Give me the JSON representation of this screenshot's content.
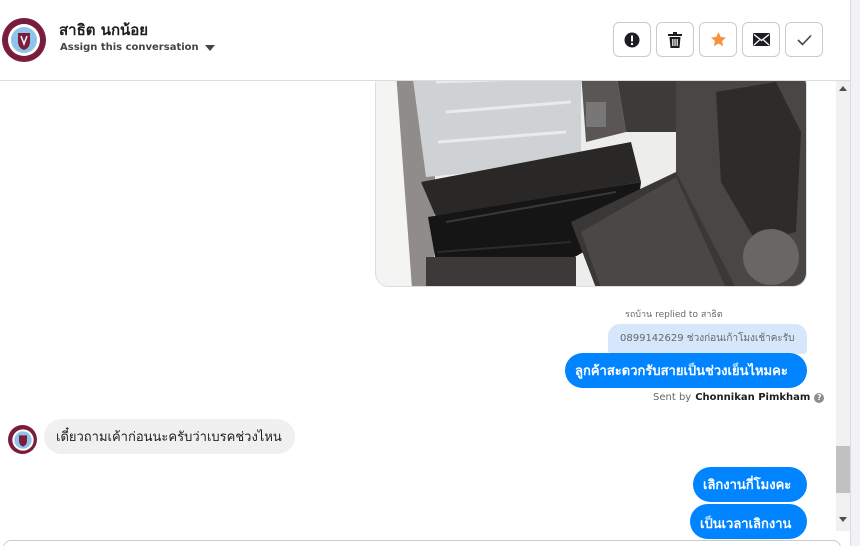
{
  "header": {
    "contact_name": "สาธิต นกน้อย",
    "assign_label": "Assign this conversation",
    "actions": [
      {
        "name": "mark-spam",
        "icon": "exclamation-icon"
      },
      {
        "name": "delete",
        "icon": "trash-icon"
      },
      {
        "name": "star",
        "icon": "star-icon"
      },
      {
        "name": "mark-unread",
        "icon": "envelope-icon"
      },
      {
        "name": "mark-done",
        "icon": "check-icon"
      }
    ]
  },
  "colors": {
    "accent": "#0084ff",
    "star": "#f7913d",
    "incoming_bubble": "#f0f0f0",
    "quoted_bubble": "#d6e6fb",
    "avatar_bg": "#7a1c3c"
  },
  "messages": {
    "reply_note": "รถบ้าน replied to สาธิต",
    "quoted_text": "0899142629 ช่วงก่อนเก้าโมงเช้าคะรับ",
    "outgoing_1": "ลูกค้าสะดวกรับสายเป็นช่วงเย็นไหมคะ",
    "sent_by_prefix": "Sent by",
    "sent_by_name": "Chonnikan Pimkham",
    "incoming_1": "เดี๋ยวถามเค้าก่อนนะครับว่าเบรคช่วงไหน",
    "outgoing_2": "เลิกงานกี่โมงคะ",
    "outgoing_3": "เป็นเวลาเลิกงาน"
  }
}
